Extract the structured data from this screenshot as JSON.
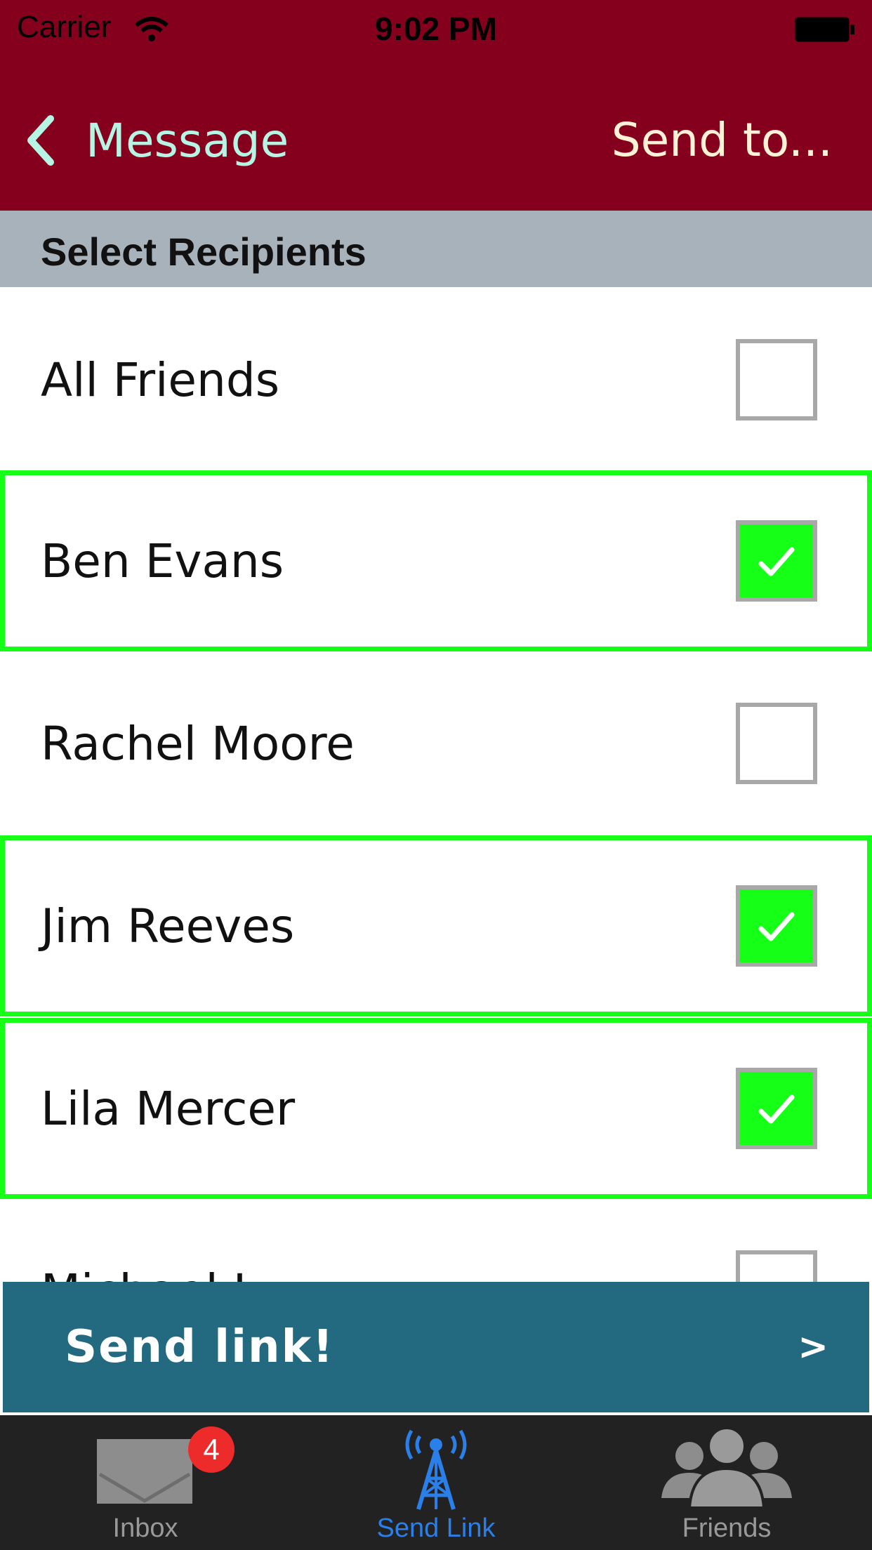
{
  "status_bar": {
    "carrier": "Carrier",
    "time": "9:02 PM"
  },
  "nav": {
    "back_label": "Message",
    "title": "Send to..."
  },
  "section_header": "Select Recipients",
  "recipients": [
    {
      "name": "All Friends",
      "checked": false
    },
    {
      "name": "Ben Evans",
      "checked": true
    },
    {
      "name": "Rachel Moore",
      "checked": false
    },
    {
      "name": "Jim Reeves",
      "checked": true
    },
    {
      "name": "Lila Mercer",
      "checked": true
    },
    {
      "name": "Michael L...",
      "checked": false
    }
  ],
  "send_button": {
    "label": "Send link!",
    "arrow": ">"
  },
  "tabs": [
    {
      "label": "Inbox",
      "badge": "4",
      "icon": "envelope-icon",
      "active": false
    },
    {
      "label": "Send Link",
      "icon": "antenna-tower-icon",
      "active": true
    },
    {
      "label": "Friends",
      "icon": "people-icon",
      "active": false
    }
  ],
  "colors": {
    "nav_bg": "#84001c",
    "accent_green": "#16ff16",
    "send_bg": "#236a80",
    "tab_active": "#2b7fe8"
  }
}
